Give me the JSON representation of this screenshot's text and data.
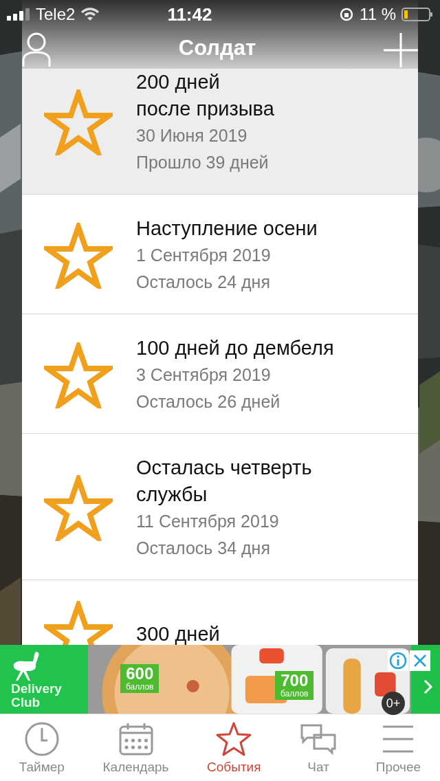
{
  "status_bar": {
    "carrier": "Tele2",
    "time": "11:42",
    "battery": "11 %"
  },
  "header": {
    "title": "Солдат"
  },
  "events": [
    {
      "title_lines": [
        "200 дней",
        "после призыва"
      ],
      "date": "30 Июня 2019",
      "remaining": "Прошло 39 дней",
      "selected": true
    },
    {
      "title_lines": [
        "Наступление осени"
      ],
      "date": "1 Сентября 2019",
      "remaining": "Осталось 24 дня",
      "selected": false
    },
    {
      "title_lines": [
        "100 дней до дембеля"
      ],
      "date": "3 Сентября 2019",
      "remaining": "Осталось 26 дней",
      "selected": false
    },
    {
      "title_lines": [
        "Осталась четверть",
        "службы"
      ],
      "date": "11 Сентября 2019",
      "remaining": "Осталось 34 дня",
      "selected": false
    },
    {
      "title_lines": [
        "300 дней"
      ],
      "selected": false
    }
  ],
  "ad": {
    "brand_lines": [
      "Delivery",
      "Club"
    ],
    "offers": [
      {
        "amount": "600",
        "unit": "баллов"
      },
      {
        "amount": "700",
        "unit": "баллов"
      }
    ],
    "age": "0+"
  },
  "tabs": [
    {
      "label": "Таймер",
      "kind": "clock",
      "selected": false
    },
    {
      "label": "Календарь",
      "kind": "calendar",
      "selected": false
    },
    {
      "label": "События",
      "kind": "star",
      "selected": true
    },
    {
      "label": "Чат",
      "kind": "chat",
      "selected": false
    },
    {
      "label": "Прочее",
      "kind": "menu",
      "selected": false
    }
  ]
}
